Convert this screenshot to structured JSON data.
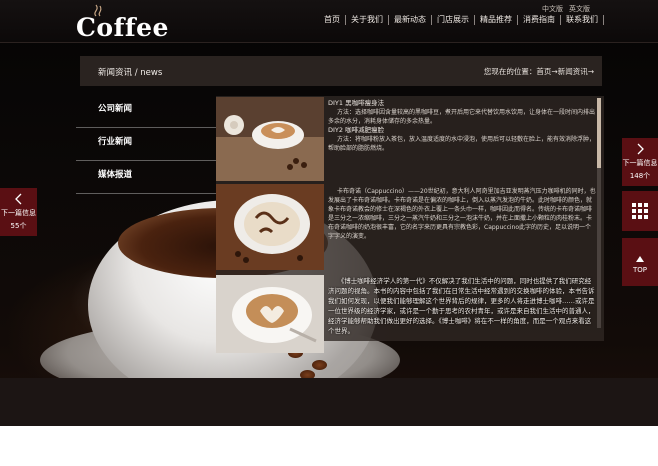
{
  "header": {
    "logo": "Coffee",
    "lang": [
      "中文版",
      "英文版"
    ],
    "nav": [
      "首页",
      "关于我们",
      "最新动态",
      "门店展示",
      "精品推荐",
      "消费指南",
      "联系我们"
    ]
  },
  "section": {
    "title": "新闻资讯 / news",
    "breadcrumb": "您现在的位置：首页→新闻资讯→"
  },
  "sidebar": {
    "items": [
      "公司新闻",
      "行业新闻",
      "媒体报道"
    ]
  },
  "articles": [
    {
      "heading1": "DIY1 黑咖啡瘦身法",
      "body1": "方法：选择咖啡因含量较高的黑咖啡豆，煮开后用它来代替饮用水饮用，让身体在一段时间内排出多余的水分，消耗身体储存的多余热量。",
      "heading2": "DIY2 咖啡减肥瘦脸",
      "body2": "方法：将咖啡粉放入茶包，放入温度适度的水中浸泡，使用后可以轻敷在脸上，能有效消除浮肿，帮助脸部的脂肪燃烧。"
    },
    {
      "body": "卡布奇诺（Cappuccino）——20世纪初，意大利人阿奇里加吉亚发明蒸汽压力咖啡机的同时，也发展出了卡布奇诺咖啡。卡布奇诺是在偏浓的咖啡上，倒入以蒸汽发泡的牛奶。此时咖啡的颜色，就象卡布奇诺教会的修士在深褐色的外衣上覆上一条头巾一样，咖啡因此而得名。传统的卡布奇诺咖啡是三分之一浓缩咖啡，三分之一蒸汽牛奶和三分之一泡沫牛奶，并在上面撒上小颗粒的肉桂粉末。卡布奇诺咖啡的奶泡很丰富，它的名字来历更具有宗教色彩，Cappuccino此字的历史，足以说明一个字字义的演变。"
    },
    {
      "body": "《博士咖啡经济学人的第一代》不仅解决了我们生活中的问题，同时也提供了我们研究经济问题的视角。本书的内容中包括了我们在日常生活中经常遇到的交换咖啡的体验，本书告诉我们如何发现，以便我们能够理解这个世界背后的规律，更多的人将走进博士咖啡……或许是一位世界级的经济学家，或许是一个勤于思考的农村青年，或许是来自我们生活中的普通人，经济学能够帮助我们做出更好的选择。《博士咖啡》将在不一样的角度，而是一个观点来看这个世界。"
    }
  ],
  "side_buttons": {
    "prev_label": "下一篇信息",
    "prev_count": "55个",
    "next_label": "下一篇信息",
    "next_count": "148个",
    "top_label": "TOP"
  }
}
